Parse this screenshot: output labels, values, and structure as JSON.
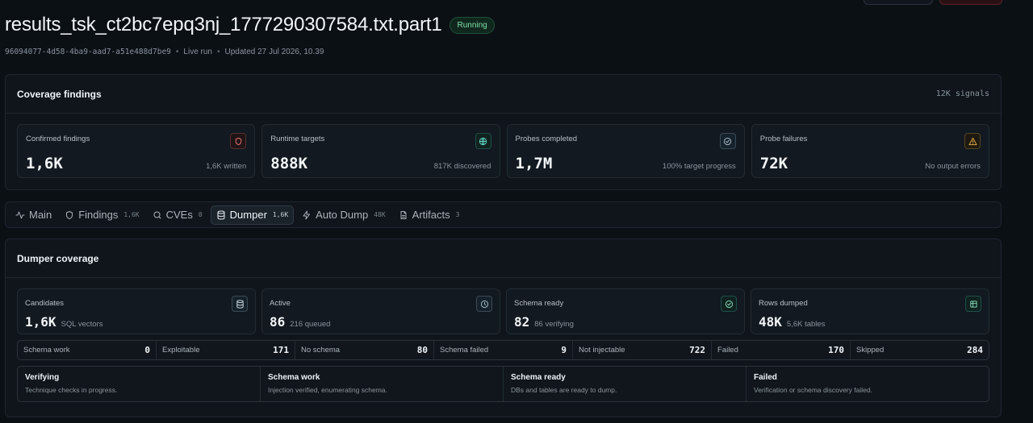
{
  "header": {
    "title": "results_tsk_ct2bc7epq3nj_1777290307584.txt.part1",
    "status": "Running",
    "id": "96094077-4d58-4ba9-aad7-a51e488d7be9",
    "mode": "Live run",
    "updated": "Updated 27 Jul 2026, 10.39"
  },
  "coverage": {
    "title": "Coverage findings",
    "signals": "12K signals",
    "stats": [
      {
        "label": "Confirmed findings",
        "value": "1,6K",
        "sub": "1,6K written",
        "icon": "shield-icon"
      },
      {
        "label": "Runtime targets",
        "value": "888K",
        "sub": "817K discovered",
        "icon": "globe-icon"
      },
      {
        "label": "Probes completed",
        "value": "1,7M",
        "sub": "100% target progress",
        "icon": "check-circle-icon"
      },
      {
        "label": "Probe failures",
        "value": "72K",
        "sub": "No output errors",
        "icon": "warning-icon"
      }
    ]
  },
  "tabs": [
    {
      "label": "Main",
      "count": "",
      "icon": "activity-icon"
    },
    {
      "label": "Findings",
      "count": "1,6K",
      "icon": "shield-icon"
    },
    {
      "label": "CVEs",
      "count": "0",
      "icon": "search-icon"
    },
    {
      "label": "Dumper",
      "count": "1,6K",
      "icon": "database-icon",
      "active": true
    },
    {
      "label": "Auto Dump",
      "count": "48K",
      "icon": "zap-icon"
    },
    {
      "label": "Artifacts",
      "count": "3",
      "icon": "file-icon"
    }
  ],
  "dumper": {
    "title": "Dumper coverage",
    "stats": [
      {
        "label": "Candidates",
        "value": "1,6K",
        "sub": "SQL vectors",
        "icon": "database-icon"
      },
      {
        "label": "Active",
        "value": "86",
        "sub": "216 queued",
        "icon": "clock-icon"
      },
      {
        "label": "Schema ready",
        "value": "82",
        "sub": "86 verifying",
        "icon": "check-circle-icon"
      },
      {
        "label": "Rows dumped",
        "value": "48K",
        "sub": "5,6K tables",
        "icon": "table-icon"
      }
    ],
    "counts": [
      {
        "label": "Schema work",
        "value": "0"
      },
      {
        "label": "Exploitable",
        "value": "171"
      },
      {
        "label": "No schema",
        "value": "80"
      },
      {
        "label": "Schema failed",
        "value": "9"
      },
      {
        "label": "Not injectable",
        "value": "722"
      },
      {
        "label": "Failed",
        "value": "170"
      },
      {
        "label": "Skipped",
        "value": "284"
      }
    ],
    "legend": [
      {
        "title": "Verifying",
        "desc": "Technique checks in progress."
      },
      {
        "title": "Schema work",
        "desc": "Injection verified, enumerating schema."
      },
      {
        "title": "Schema ready",
        "desc": "DBs and tables are ready to dump."
      },
      {
        "title": "Failed",
        "desc": "Verification or schema discovery failed."
      }
    ]
  }
}
